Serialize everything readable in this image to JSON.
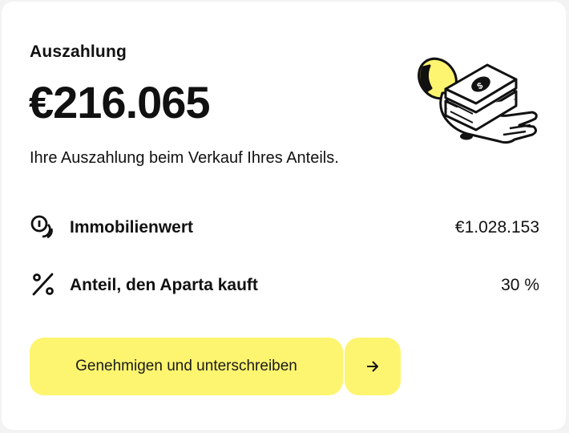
{
  "payout": {
    "title": "Auszahlung",
    "amount": "€216.065",
    "description": "Ihre Auszahlung beim Verkauf Ihres Anteils."
  },
  "details": [
    {
      "icon": "coins-icon",
      "label": "Immobilienwert",
      "value": "€1.028.153"
    },
    {
      "icon": "percent-icon",
      "label": "Anteil, den Aparta kauft",
      "value": "30 %"
    }
  ],
  "actions": {
    "primary_label": "Genehmigen und unterschreiben",
    "arrow_icon": "arrow-right-icon"
  },
  "colors": {
    "accent": "#fdf56f",
    "text": "#111111",
    "background": "#ffffff"
  }
}
